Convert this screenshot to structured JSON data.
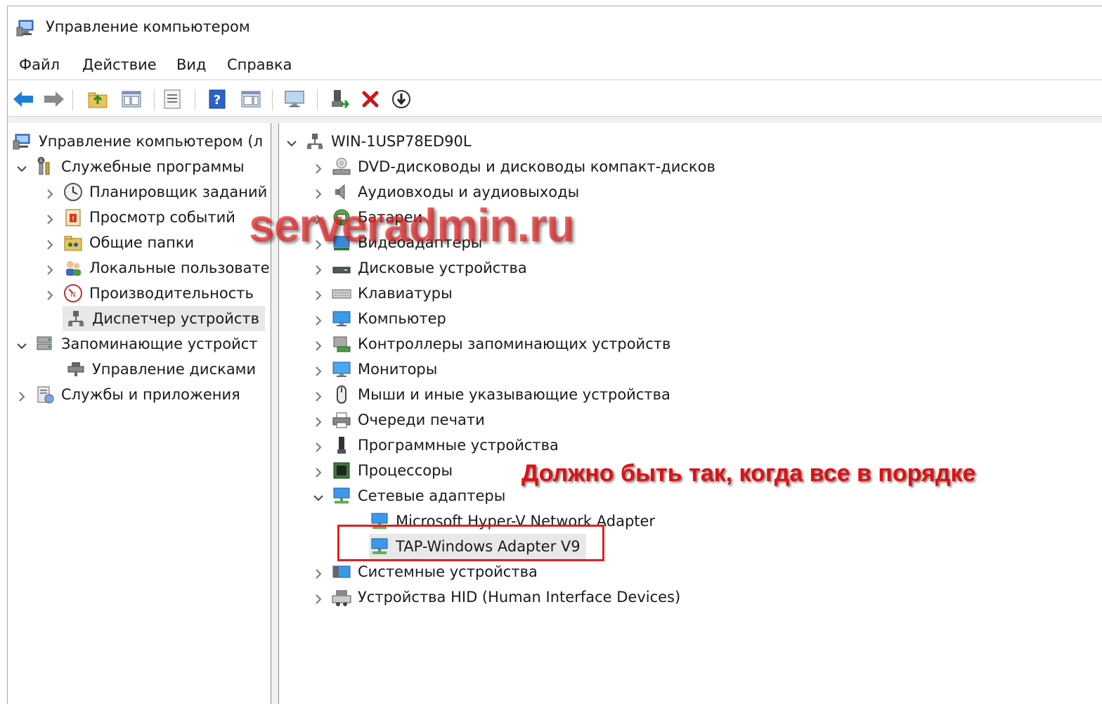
{
  "window": {
    "title": "Управление компьютером"
  },
  "menu": [
    "Файл",
    "Действие",
    "Вид",
    "Справка"
  ],
  "toolbar": {
    "icons": [
      "back-icon",
      "forward-icon",
      "up-folder-icon",
      "show-hide-tree-icon",
      "export-list-icon",
      "help-icon",
      "show-hide-action-pane-icon",
      "monitor-icon",
      "enable-device-icon",
      "uninstall-icon",
      "update-driver-icon"
    ],
    "colors": {
      "back": "#1e7fd6",
      "delete": "#d21414",
      "help": "#2a63c8"
    }
  },
  "left_tree": {
    "root": "Управление компьютером (л",
    "system_tools": "Служебные программы",
    "task_scheduler": "Планировщик заданий",
    "event_viewer": "Просмотр событий",
    "shared_folders": "Общие папки",
    "local_users": "Локальные пользовате",
    "performance": "Производительность",
    "device_manager": "Диспетчер устройств",
    "storage": "Запоминающие устройст",
    "disk_management": "Управление дисками",
    "services_apps": "Службы и приложения"
  },
  "right_tree": {
    "computer_name": "WIN-1USP78ED90L",
    "categories": [
      "DVD-дисководы и дисководы компакт-дисков",
      "Аудиовходы и аудиовыходы",
      "Батареи",
      "Видеоадаптеры",
      "Дисковые устройства",
      "Клавиатуры",
      "Компьютер",
      "Контроллеры запоминающих устройств",
      "Мониторы",
      "Мыши и иные указывающие устройства",
      "Очереди печати",
      "Программные устройства",
      "Процессоры",
      "Сетевые адаптеры"
    ],
    "network_adapters": [
      "Microsoft Hyper-V Network Adapter",
      "TAP-Windows Adapter V9"
    ],
    "after": [
      "Системные устройства",
      "Устройства HID (Human Interface Devices)"
    ]
  },
  "annotation": "Должно быть так, когда все в порядке",
  "watermark": "serveradmin.ru",
  "colors": {
    "annotation": "#e01010",
    "highlight_box": "#e02020",
    "selection": "#e8e8e8"
  }
}
